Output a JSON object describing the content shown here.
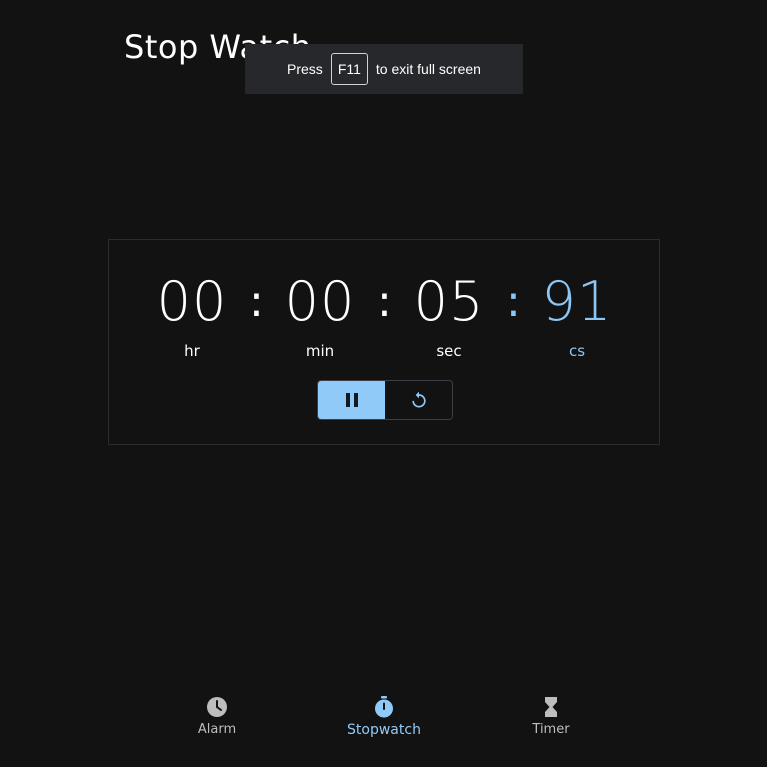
{
  "page": {
    "title": "Stop Watch"
  },
  "fullscreen_toast": {
    "prefix": "Press",
    "key": "F11",
    "suffix": "to exit full screen"
  },
  "stopwatch": {
    "hours": {
      "value": "00",
      "unit": "hr"
    },
    "minutes": {
      "value": "00",
      "unit": "min"
    },
    "seconds": {
      "value": "05",
      "unit": "sec"
    },
    "centiseconds": {
      "value": "91",
      "unit": "cs"
    },
    "separator": ":",
    "controls": {
      "pause_icon": "pause-icon",
      "reset_icon": "reset-icon"
    }
  },
  "bottom_nav": {
    "items": [
      {
        "label": "Alarm",
        "icon": "clock-icon",
        "active": false
      },
      {
        "label": "Stopwatch",
        "icon": "stopwatch-icon",
        "active": true
      },
      {
        "label": "Timer",
        "icon": "hourglass-icon",
        "active": false
      }
    ]
  },
  "colors": {
    "background": "#121212",
    "accent": "#90caf9",
    "card_border": "#2c2c2c",
    "toast_background": "#26282c",
    "nav_inactive": "#bdbdbd"
  }
}
